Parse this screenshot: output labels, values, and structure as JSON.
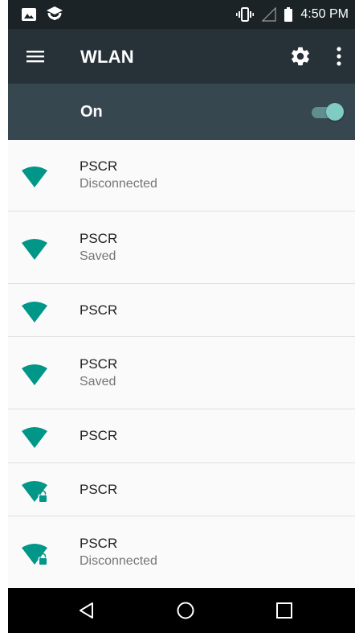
{
  "status_bar": {
    "time": "4:50 PM",
    "left_icons": [
      "image-icon",
      "app-notification-icon"
    ],
    "right_icons": [
      "vibrate-icon",
      "signal-icon",
      "battery-icon"
    ]
  },
  "toolbar": {
    "title": "WLAN",
    "icons": [
      "menu-icon",
      "gear-icon",
      "more-vert-icon"
    ]
  },
  "wifi_switch": {
    "label": "On",
    "state": true
  },
  "networks": [
    {
      "ssid": "PSCR",
      "status": "Disconnected",
      "secured": false
    },
    {
      "ssid": "PSCR",
      "status": "Saved",
      "secured": false
    },
    {
      "ssid": "PSCR",
      "status": "",
      "secured": false
    },
    {
      "ssid": "PSCR",
      "status": "Saved",
      "secured": false
    },
    {
      "ssid": "PSCR",
      "status": "",
      "secured": false
    },
    {
      "ssid": "PSCR",
      "status": "",
      "secured": true
    },
    {
      "ssid": "PSCR",
      "status": "Disconnected",
      "secured": true
    }
  ],
  "nav_bar": {
    "buttons": [
      "back-icon",
      "home-icon",
      "recents-icon"
    ]
  },
  "colors": {
    "status_bar": "#1b2327",
    "toolbar": "#263238",
    "switch_bar": "#37474f",
    "wifi_icon": "#009688",
    "toggle_thumb": "#80cbc4"
  }
}
